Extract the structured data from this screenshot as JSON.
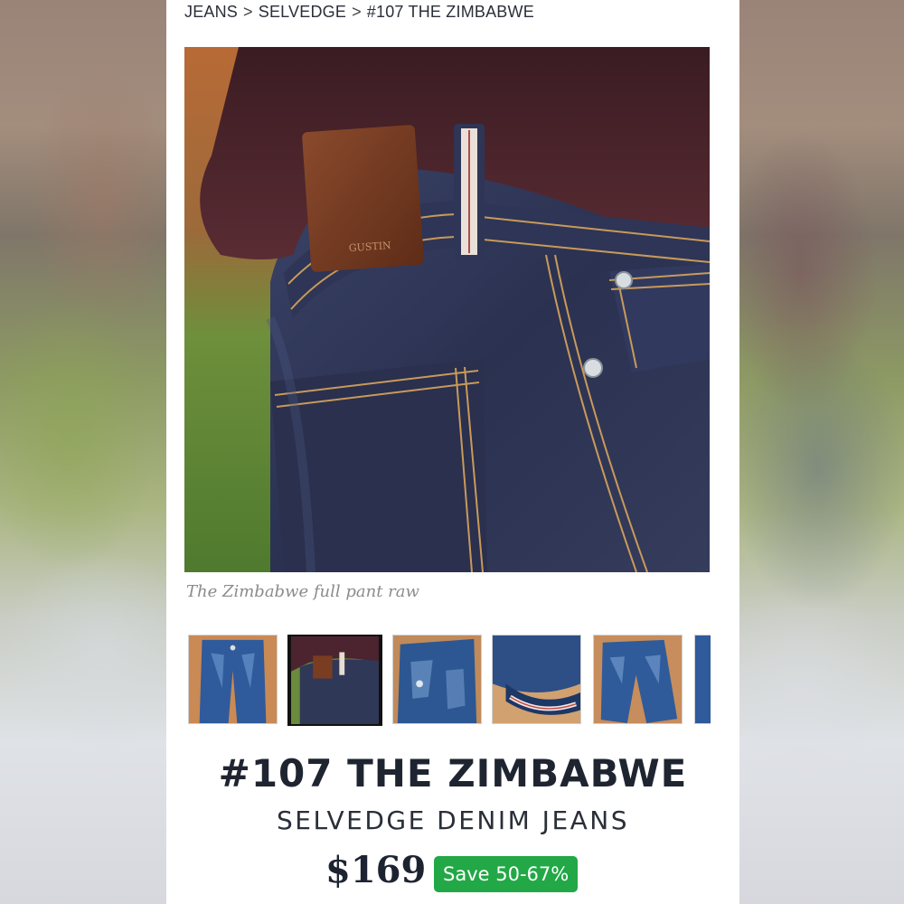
{
  "breadcrumb": {
    "items": [
      "JEANS",
      "SELVEDGE",
      "#107 THE ZIMBABWE"
    ],
    "separator": ">"
  },
  "gallery": {
    "caption": "The Zimbabwe full pant raw",
    "thumbnails": [
      {
        "label": "front-faded"
      },
      {
        "label": "back-raw"
      },
      {
        "label": "front-distressed"
      },
      {
        "label": "cuff-selvedge"
      },
      {
        "label": "front-faded-floor"
      },
      {
        "label": "partial-next"
      }
    ],
    "active_index": 1
  },
  "product": {
    "title": "#107 THE ZIMBABWE",
    "subtitle": "SELVEDGE DENIM JEANS",
    "price": "$169",
    "save_badge": "Save 50-67%"
  },
  "colors": {
    "badge_green": "#22a846",
    "title_text": "#1f2530"
  }
}
